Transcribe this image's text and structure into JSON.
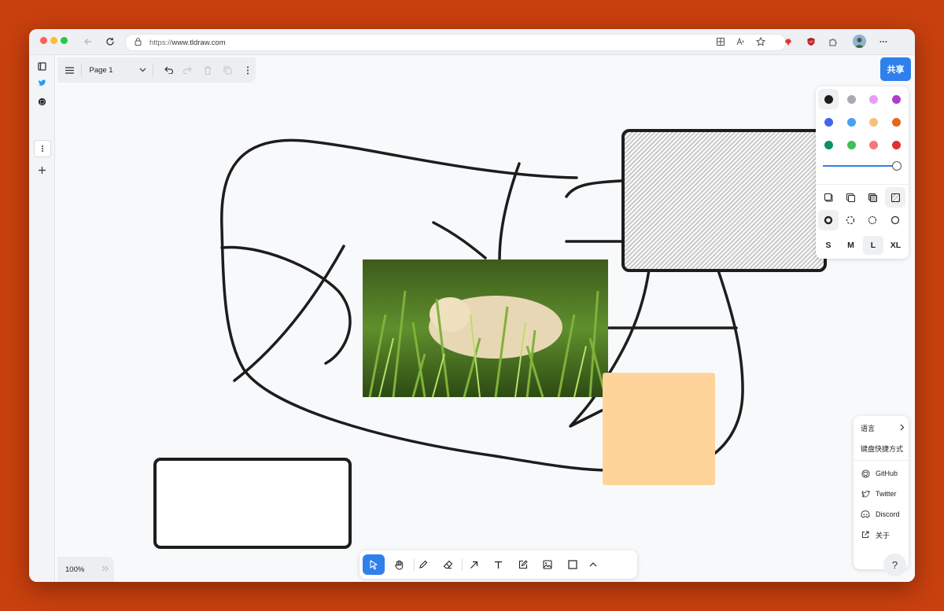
{
  "browser": {
    "url_prefix": "https://",
    "url_host": "www.tldraw.com"
  },
  "menu": {
    "page_name": "Page 1"
  },
  "share_label": "共享",
  "zoom_level": "100%",
  "help_menu": {
    "language": "语言",
    "shortcuts": "键盘快捷方式",
    "github": "GitHub",
    "twitter": "Twitter",
    "discord": "Discord",
    "about": "关于"
  },
  "help_button": "?",
  "style_panel": {
    "colors": [
      "#1d1d1d",
      "#a8acb2",
      "#e69df2",
      "#ae3ec9",
      "#4465e9",
      "#4ba1f1",
      "#f8c07d",
      "#e16919",
      "#099268",
      "#40c057",
      "#f87777",
      "#e03131"
    ],
    "opacity": 1.0,
    "sizes": [
      "S",
      "M",
      "L",
      "XL"
    ],
    "selected_size": "L"
  },
  "colors": {
    "accent": "#2f80ed",
    "sticky_note": "#fed49a",
    "background": "#c8400e"
  },
  "tools": [
    "select-tool",
    "hand-tool",
    "draw-tool",
    "eraser-tool",
    "arrow-tool",
    "text-tool",
    "note-tool",
    "asset-tool",
    "rectangle-tool",
    "more-tools"
  ]
}
